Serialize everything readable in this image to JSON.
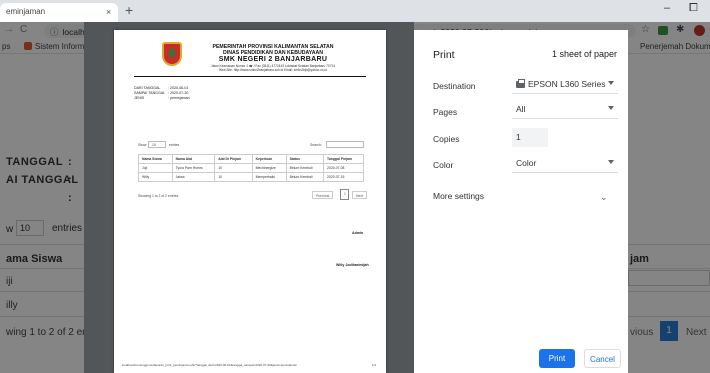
{
  "browser": {
    "tab_title": "eminjaman",
    "tab_close": "×",
    "new_tab": "+",
    "minimize": "–",
    "maximize": "⧠",
    "back": "←",
    "forward": "→",
    "reload": "C",
    "url": "localhost/menunggumu/laporan_print_peminjaman.php?tanggal_dari=2020-06-01&tanggal_sampai=2020-07-30&jenis=peminjaman",
    "star": "☆",
    "bookmarks": {
      "apps": "ps",
      "item1": "Sistem Informa",
      "item_right": "Penerjemah Dokum..."
    }
  },
  "background_page": {
    "label1": "TANGGAL",
    "label1_colon": ":",
    "label2": "AI TANGGAL",
    "label2_colon": ":",
    "label3_colon": ":",
    "show": "w",
    "entries_value": "10",
    "entries_label": "entries",
    "col_nama": "ama Siswa",
    "col_jam": "jam",
    "row1": "iji",
    "row2": "illy",
    "showing": "wing 1 to 2 of 2 ent",
    "prev": "vious",
    "page": "1",
    "next": "Next"
  },
  "preview": {
    "kop_line1": "PEMERINTAH PROVINSI KALIMANTAN SELATAN",
    "kop_line2": "DINAS PENDIDIKAN DAN KEBUDAYAAN",
    "kop_line3": "SMK NEGERI 2 BANJARBARU",
    "kop_addr1": "Jalan Keamanan Nomor 1 ☎ / Fax (0511) 4772443 Loktabat Selatan Banjarbaru 70714",
    "kop_addr2": "Web Site: http://www.smkn2banjarbaru.sch.id Email: smkn2bjb@yahoo.co.id",
    "meta_k1": "DARI TANGGAL",
    "meta_k2": "SAMPAI TANGGAL",
    "meta_k3": "JENIS",
    "meta_v1": ": 2020-06-01",
    "meta_v2": ": 2020-07-30",
    "meta_v3": ": peminjaman",
    "show_label": "Show",
    "show_value": "10",
    "entries_label": "entries",
    "search_label": "Search:",
    "table_headers": [
      "Nama Siswa",
      "Nama Alat",
      "Alat Di Pinjam",
      "Keperluan",
      "Status",
      "Tanggal Pinjam"
    ],
    "rows": [
      [
        "Juji",
        "Tyo/a Pam Hsmrs",
        "10",
        "Mechinergize",
        "Belum Kembali",
        "2020-07-08"
      ],
      [
        "Willy",
        "Jaksa",
        "10",
        "Memperbaiki",
        "Belum Kembali",
        "2020-07-15"
      ]
    ],
    "showing": "Showing 1 to 2 of 2 entries",
    "prev": "Previous",
    "page": "1",
    "next": "Next",
    "sign1": "Admin",
    "sign2": "Willy Jodiharimijah",
    "footer_url": "localhost/menunggumu/laporan_print_peminjaman.php?tanggal_dari=2020-06-01&tanggal_sampai=2020-07-30&jenis=peminjaman",
    "footer_page": "1/1"
  },
  "print_panel": {
    "title": "Print",
    "sheets": "1 sheet of paper",
    "destination_label": "Destination",
    "destination_value": "EPSON L360 Series",
    "pages_label": "Pages",
    "pages_value": "All",
    "copies_label": "Copies",
    "copies_value": "1",
    "color_label": "Color",
    "color_value": "Color",
    "more_settings": "More settings",
    "print_button": "Print",
    "cancel_button": "Cancel"
  }
}
